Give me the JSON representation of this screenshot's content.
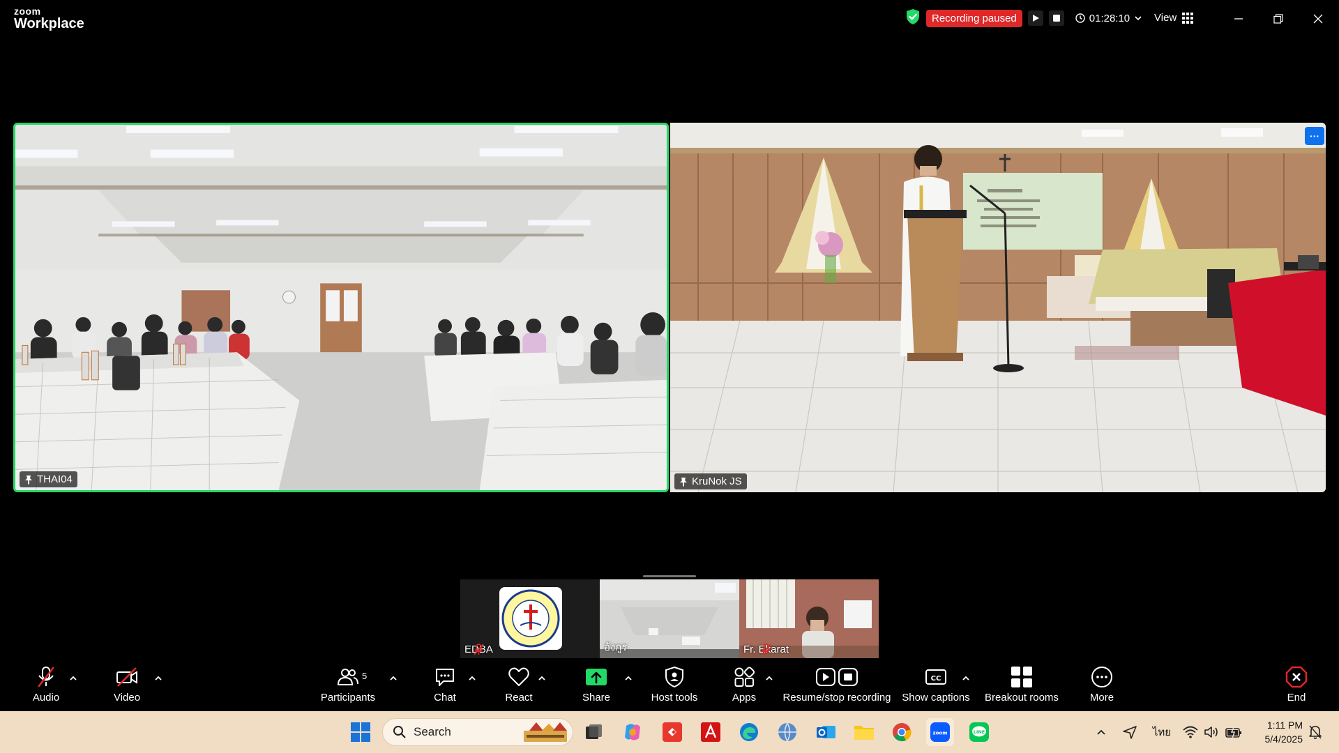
{
  "app": {
    "logo_top": "zoom",
    "logo_bottom": "Workplace"
  },
  "titlebar": {
    "recording_status": "Recording paused",
    "timer": "01:28:10",
    "view_label": "View"
  },
  "videos": [
    {
      "name": "THAI04",
      "pinned": true,
      "active_speaker": true
    },
    {
      "name": "KruNok JS",
      "pinned": true,
      "active_speaker": false
    }
  ],
  "thumbnails": [
    {
      "name": "EDBA",
      "muted": true
    },
    {
      "name": "อังกูร",
      "muted": false
    },
    {
      "name": "Fr. Ekarat",
      "muted": true
    }
  ],
  "toolbar": {
    "audio": "Audio",
    "video": "Video",
    "participants": "Participants",
    "participants_count": "5",
    "chat": "Chat",
    "react": "React",
    "share": "Share",
    "host_tools": "Host tools",
    "apps": "Apps",
    "recording": "Resume/stop recording",
    "captions": "Show captions",
    "breakout": "Breakout rooms",
    "more": "More",
    "end": "End"
  },
  "taskbar": {
    "search_placeholder": "Search",
    "language": "ไทย",
    "time": "1:11 PM",
    "date": "5/4/2025"
  },
  "colors": {
    "active_border": "#23d967",
    "recording_red": "#e02828",
    "share_green": "#23d967",
    "end_red": "#e02828",
    "accent_blue": "#0e72ed",
    "taskbar_bg": "#f0ddc4"
  }
}
